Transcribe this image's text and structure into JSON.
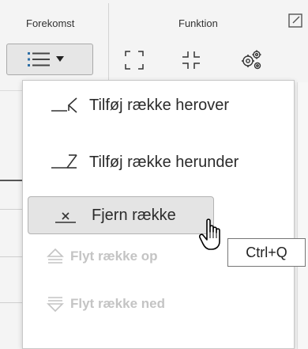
{
  "ribbon": {
    "group_forekomst": "Forekomst",
    "group_funktion": "Funktion",
    "layout_button_icon": "list-dropdown-icon",
    "function_icons": [
      "expand-icon",
      "collapse-icon",
      "gears-icon"
    ]
  },
  "menu": {
    "items": [
      {
        "label": "Tilføj række herover",
        "icon": "insert-row-above-icon",
        "state": "normal"
      },
      {
        "label": "Tilføj række herunder",
        "icon": "insert-row-below-icon",
        "state": "normal"
      },
      {
        "label": "Fjern række",
        "icon": "remove-row-icon",
        "state": "hovered"
      },
      {
        "label": "Flyt række op",
        "icon": "move-up-icon",
        "state": "disabled"
      },
      {
        "label": "Flyt række ned",
        "icon": "move-down-icon",
        "state": "disabled"
      }
    ]
  },
  "tooltip": {
    "text": "Ctrl+Q"
  },
  "colors": {
    "menu_bg": "#ffffff",
    "hover_bg": "#e4e4e4",
    "disabled_text": "#c4c4c4",
    "ribbon_bg": "#f4f4f4"
  }
}
